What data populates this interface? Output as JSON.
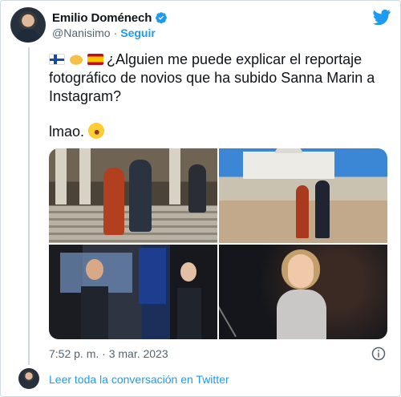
{
  "tweet": {
    "display_name": "Emilio Doménech",
    "handle": "@Nanisimo",
    "separator": "·",
    "follow_label": "Seguir",
    "verified": true,
    "text": "¿Alguien me puede explicar el reportaje fotográfico de novios que ha subido Sanna Marin a Instagram?",
    "emojis_leading": [
      "flag-finland",
      "handshake",
      "flag-spain"
    ],
    "text_second": "lmao.",
    "emoji_trailing": "rolling-on-floor-laughing",
    "photos": [
      "photo-steps-couple",
      "photo-cathedral-couple",
      "photo-press-conference",
      "photo-woman-speaking"
    ],
    "timestamp": "7:52 p. m. · 3 mar. 2023"
  },
  "footer": {
    "read_conversation": "Leer toda la conversación en Twitter"
  },
  "colors": {
    "accent": "#1d9bf0",
    "text": "#0f1419",
    "secondary": "#536471",
    "border": "#cfd9de"
  },
  "icons": [
    "twitter-bird-icon",
    "verified-badge-icon",
    "info-icon"
  ]
}
